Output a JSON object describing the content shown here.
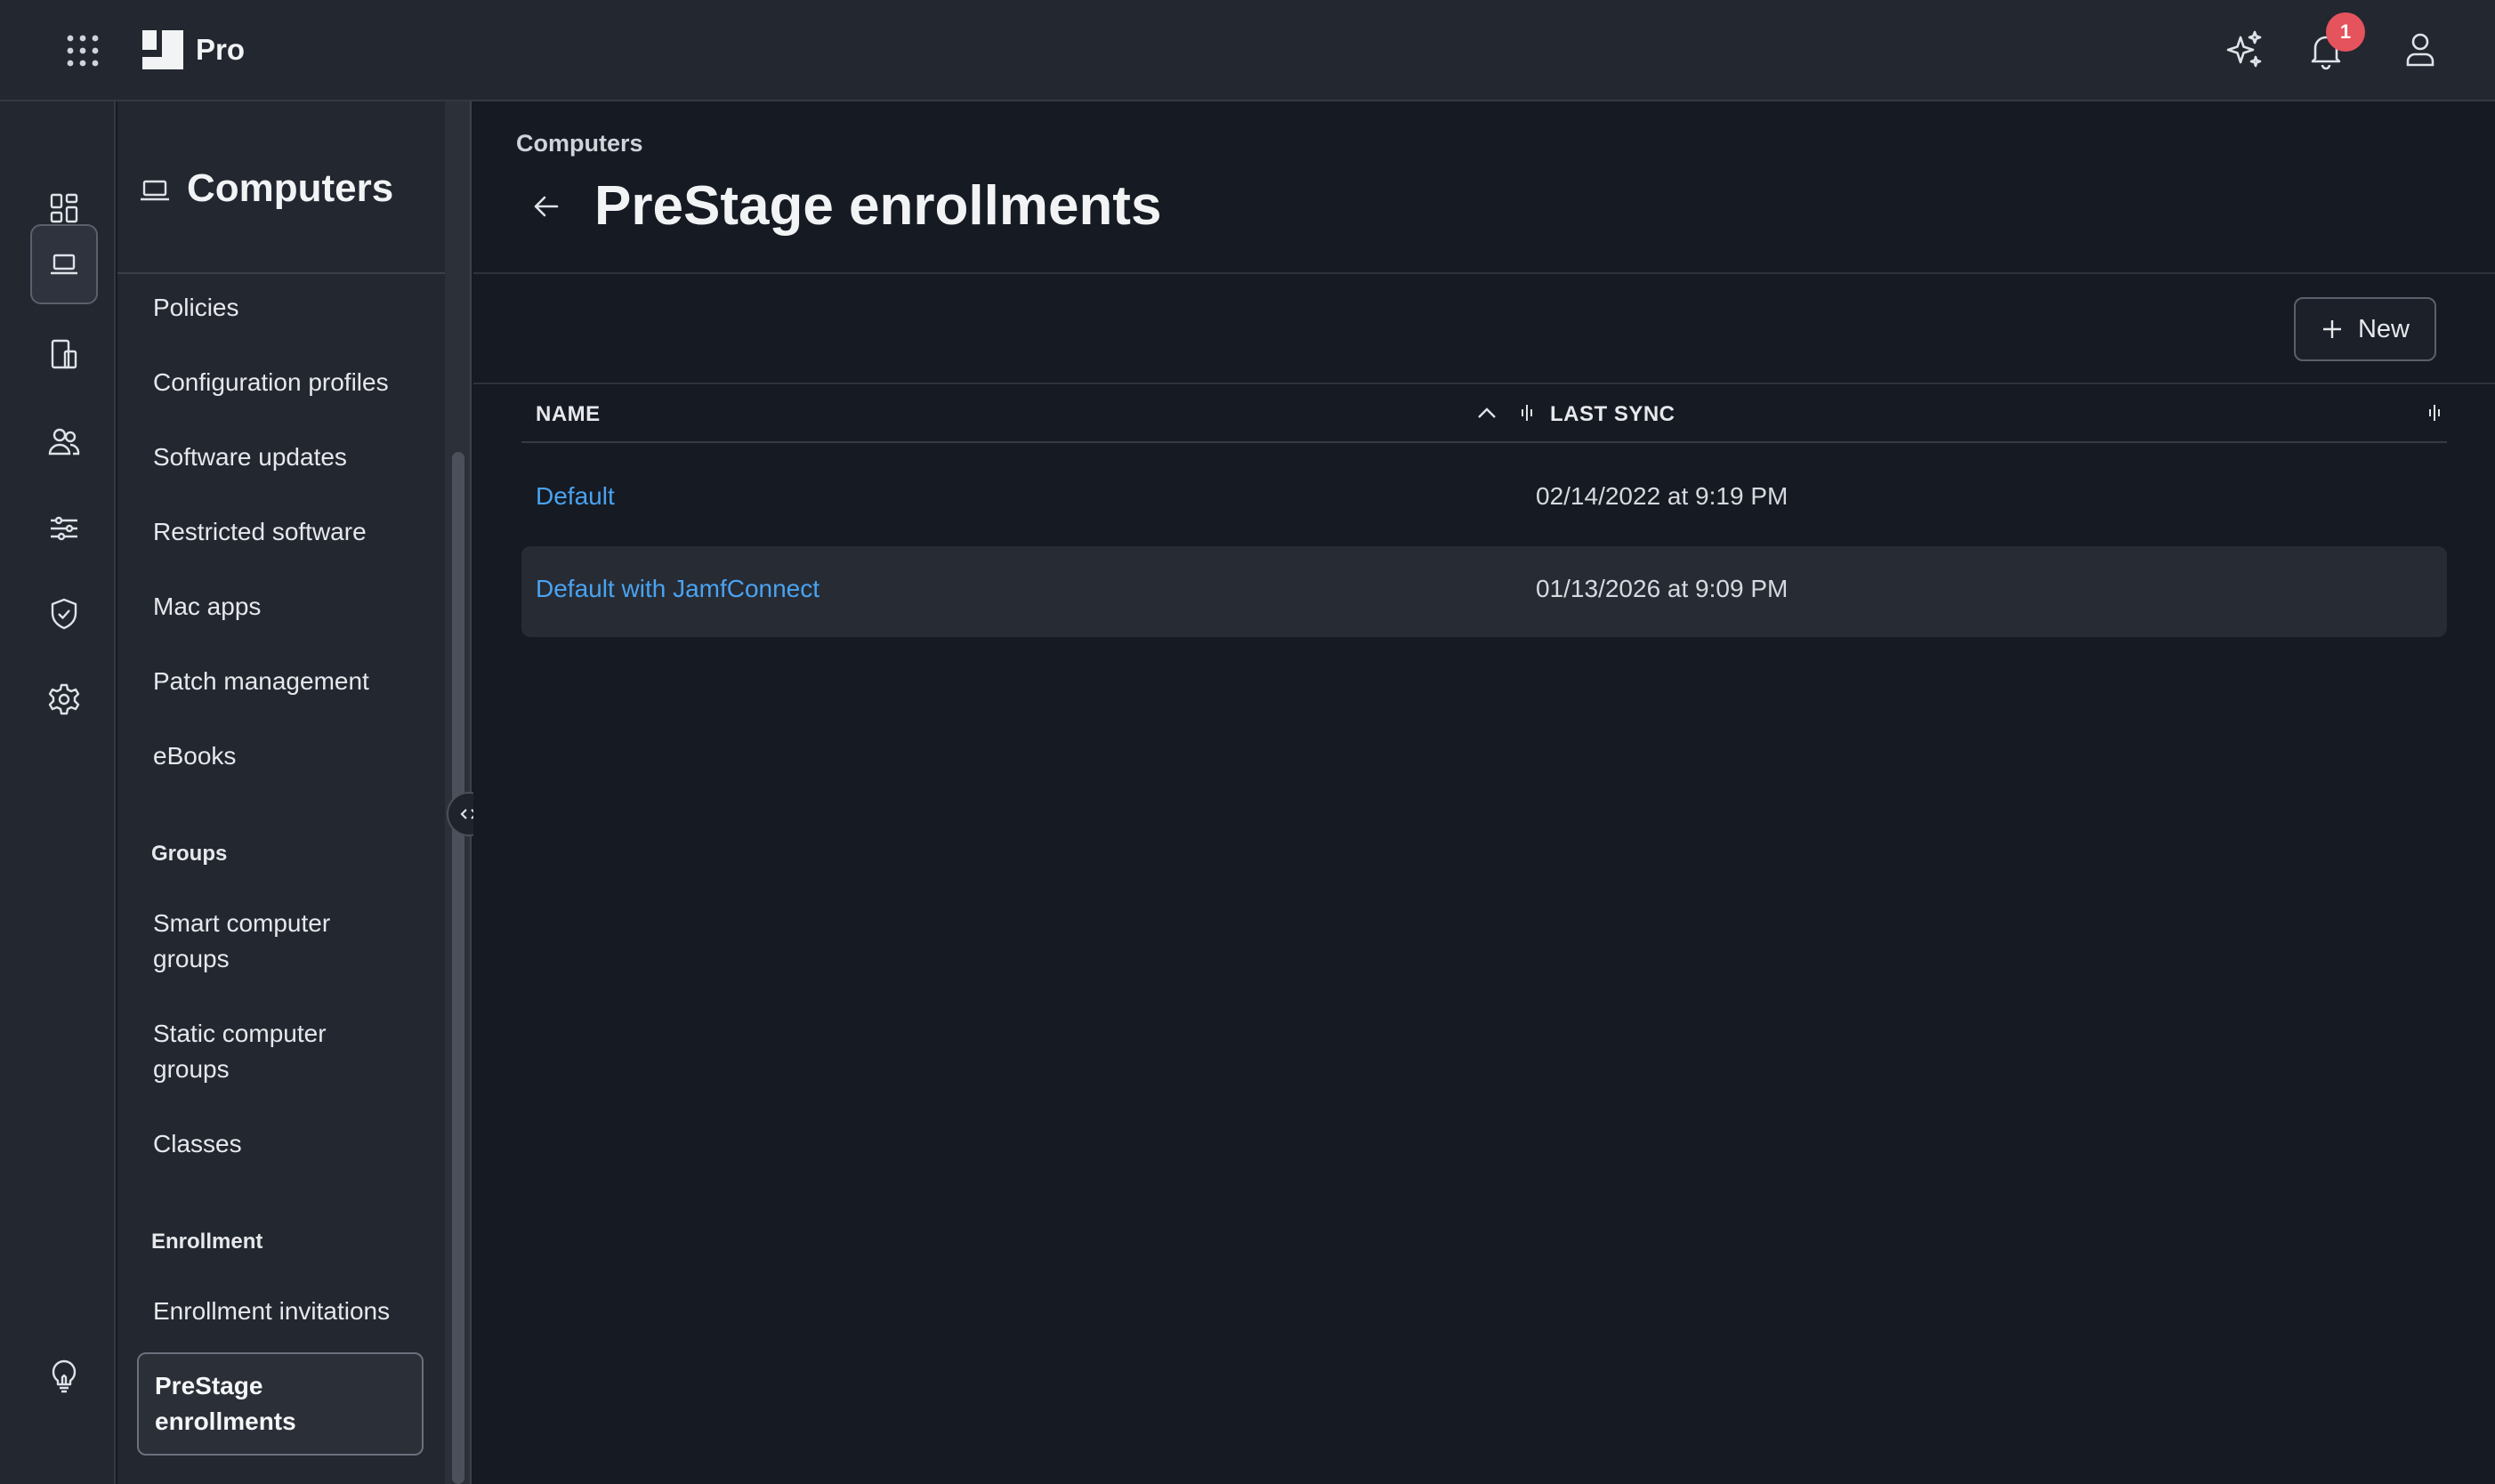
{
  "app": {
    "brand": "Pro",
    "notification_count": "1"
  },
  "rail": {
    "icons": [
      "dashboard-icon",
      "laptop-icon",
      "mobile-devices-icon",
      "users-icon",
      "settings-sliders-icon",
      "shield-icon",
      "gear-icon",
      "lightbulb-icon"
    ],
    "active": "laptop-icon"
  },
  "subnav": {
    "title": "Computers",
    "items": [
      {
        "label": "Policies"
      },
      {
        "label": "Configuration profiles"
      },
      {
        "label": "Software updates"
      },
      {
        "label": "Restricted software"
      },
      {
        "label": "Mac apps"
      },
      {
        "label": "Patch management"
      },
      {
        "label": "eBooks"
      }
    ],
    "groups_heading": "Groups",
    "groups": [
      {
        "label": "Smart computer groups"
      },
      {
        "label": "Static computer groups"
      },
      {
        "label": "Classes"
      }
    ],
    "enrollment_heading": "Enrollment",
    "enrollment": [
      {
        "label": "Enrollment invitations"
      },
      {
        "label": "PreStage enrollments"
      }
    ]
  },
  "main": {
    "breadcrumb": "Computers",
    "title": "PreStage enrollments",
    "new_button": "New",
    "table": {
      "columns": [
        "NAME",
        "LAST SYNC"
      ],
      "rows": [
        {
          "name": "Default",
          "last_sync": "02/14/2022 at 9:19 PM"
        },
        {
          "name": "Default with JamfConnect",
          "last_sync": "01/13/2026 at 9:09 PM"
        }
      ]
    }
  },
  "colors": {
    "link": "#4aa3f0",
    "badge": "#e5535c",
    "background": "#161a22",
    "panel": "#232730"
  }
}
